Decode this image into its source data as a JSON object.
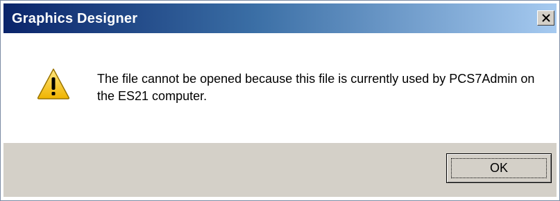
{
  "window": {
    "title": "Graphics Designer"
  },
  "titlebar": {
    "close_icon": "close-icon"
  },
  "dialog": {
    "icon": "warning-icon",
    "message": "The file cannot be opened because this file is currently used by PCS7Admin on the ES21 computer."
  },
  "buttons": {
    "ok_label": "OK"
  },
  "colors": {
    "titlebar_start": "#0a246a",
    "titlebar_end": "#a6caf0",
    "button_area": "#d4d0c8",
    "warning_yellow": "#f5c400"
  }
}
